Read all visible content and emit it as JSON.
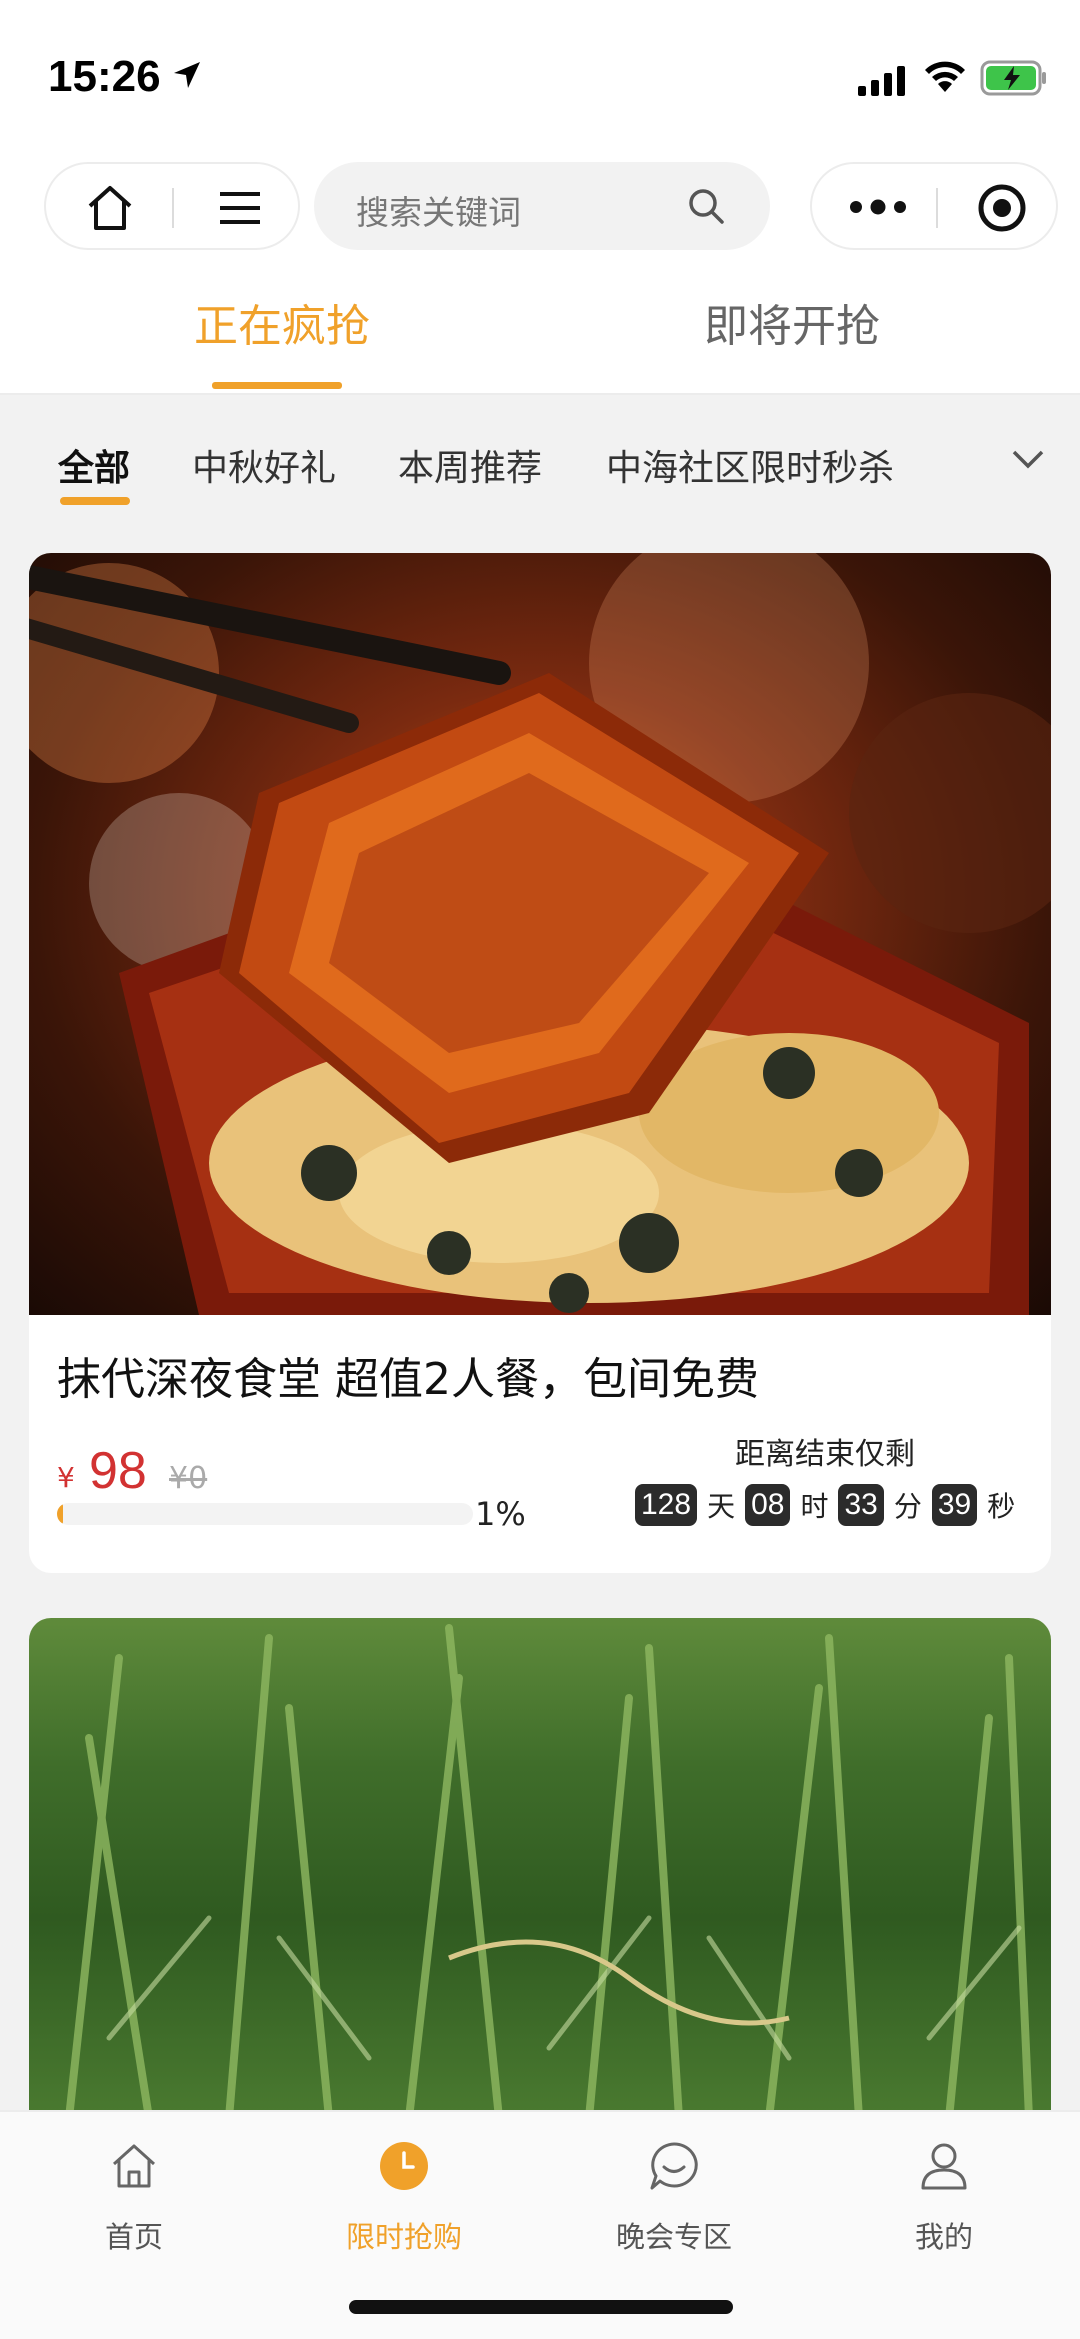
{
  "status_bar": {
    "time": "15:26"
  },
  "search": {
    "placeholder": "搜索关键词"
  },
  "segments": [
    {
      "label": "正在疯抢",
      "active": true
    },
    {
      "label": "即将开抢",
      "active": false
    }
  ],
  "categories": [
    {
      "label": "全部",
      "active": true
    },
    {
      "label": "中秋好礼",
      "active": false
    },
    {
      "label": "本周推荐",
      "active": false
    },
    {
      "label": "中海社区限时秒杀",
      "active": false
    }
  ],
  "product": {
    "title": "抹代深夜食堂 超值2人餐，包间免费",
    "currency": "¥",
    "price": "98",
    "original_price": "¥0",
    "progress_fraction": 0.01,
    "progress_label": "1%",
    "countdown_label": "距离结束仅剩",
    "countdown": {
      "days": "128",
      "days_unit": "天",
      "hours": "08",
      "hours_unit": "时",
      "minutes": "33",
      "minutes_unit": "分",
      "seconds": "39",
      "seconds_unit": "秒"
    }
  },
  "tabbar": [
    {
      "label": "首页",
      "icon": "house-icon",
      "active": false
    },
    {
      "label": "限时抢购",
      "icon": "clock-icon",
      "active": true
    },
    {
      "label": "晚会专区",
      "icon": "chat-bubble-icon",
      "active": false
    },
    {
      "label": "我的",
      "icon": "person-icon",
      "active": false
    }
  ],
  "colors": {
    "accent": "#f0a12a",
    "price": "#d23232",
    "countdown_box": "#2b2b2b"
  }
}
